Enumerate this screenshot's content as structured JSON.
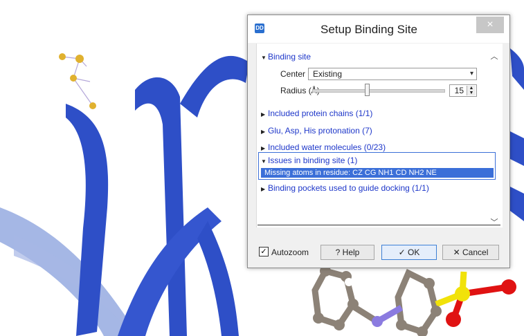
{
  "dialog": {
    "app_icon_text": "DD",
    "title": "Setup Binding Site",
    "close_icon": "×",
    "sections": {
      "binding_site": "Binding site",
      "included_protein_chains": "Included protein chains (1/1)",
      "protonation": "Glu, Asp, His protonation (7)",
      "water_molecules": "Included water molecules (0/23)",
      "issues": "Issues in binding site (1)",
      "pockets": "Binding pockets used to guide docking (1/1)"
    },
    "center_label": "Center",
    "center_value": "Existing",
    "radius_label": "Radius (Å)",
    "radius_value": "15",
    "radius_slider_fraction": 0.42,
    "issue_text": "Missing atoms in residue: CZ CG NH1 CD NH2 NE",
    "autozoom_label": "Autozoom",
    "autozoom_checked": true,
    "help_label": "? Help",
    "ok_label": "✓ OK",
    "cancel_label": "✕ Cancel"
  },
  "colors": {
    "protein_ribbon": "#2e4fc7",
    "ribbon_light": "#6f8fd8",
    "link_blue": "#1d36c9",
    "selection_blue": "#3b6fd8",
    "sulfur_yellow": "#f1e20a",
    "oxygen_red": "#e01212",
    "carbon_gray": "#8c8277",
    "nitrogen_purple": "#8b7be0",
    "ligand_gold": "#e0b12f"
  }
}
